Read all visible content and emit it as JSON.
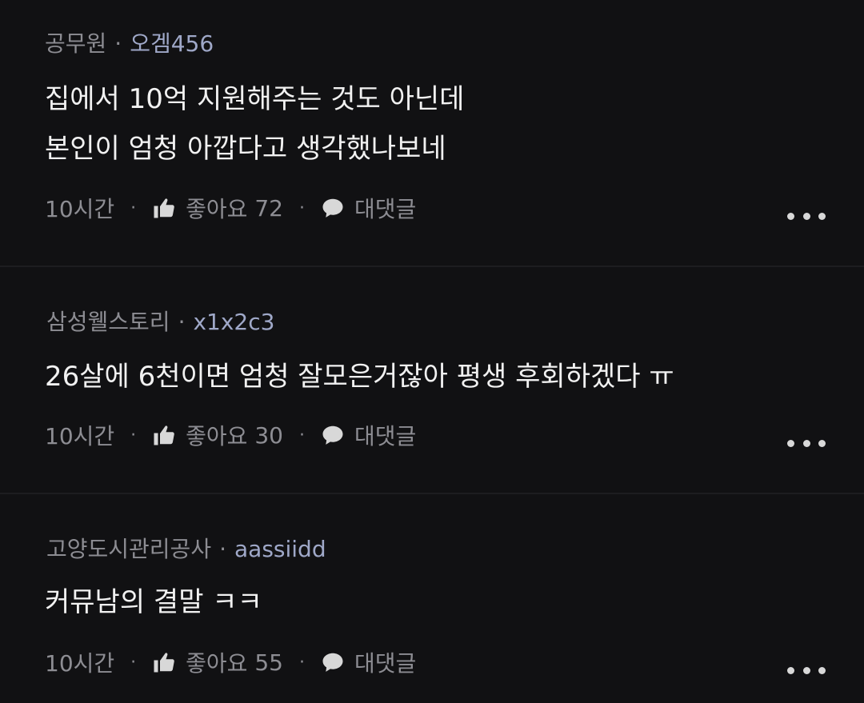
{
  "comments": [
    {
      "affiliation": "공무원",
      "separator": "·",
      "nickname": "오겜456",
      "lines": [
        "집에서 10억 지원해주는 것도 아닌데",
        "본인이 엄청 아깝다고 생각했나보네"
      ],
      "time": "10시간",
      "like_label": "좋아요",
      "like_count": "72",
      "reply_label": "대댓글"
    },
    {
      "affiliation": "삼성웰스토리",
      "separator": "·",
      "nickname": "x1x2c3",
      "lines": [
        "26살에 6천이면 엄청 잘모은거잖아 평생 후회하겠다 ㅠ"
      ],
      "time": "10시간",
      "like_label": "좋아요",
      "like_count": "30",
      "reply_label": "대댓글"
    },
    {
      "affiliation": "고양도시관리공사",
      "separator": "·",
      "nickname": "aassiidd",
      "lines": [
        "커뮤남의 결말 ㅋㅋ"
      ],
      "time": "10시간",
      "like_label": "좋아요",
      "like_count": "55",
      "reply_label": "대댓글"
    }
  ],
  "meta_separator": "·",
  "icons": {
    "like": "thumbs-up-icon",
    "reply": "speech-bubble-icon",
    "more": "more-dots-icon"
  },
  "colors": {
    "background": "#111113",
    "text": "#f1f1f1",
    "muted": "#8d8d93",
    "nickname": "#9fa8c8"
  }
}
